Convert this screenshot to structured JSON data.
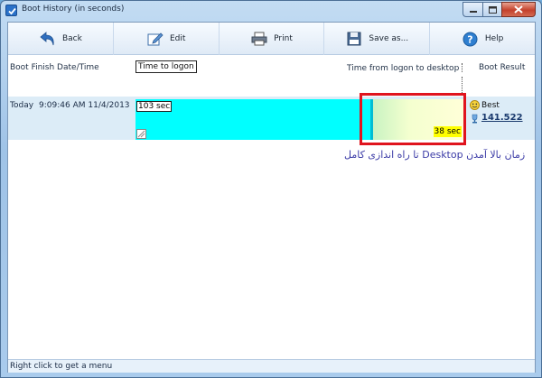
{
  "window": {
    "title": "Boot History (in seconds)"
  },
  "toolbar": {
    "back_label": "Back",
    "edit_label": "Edit",
    "print_label": "Print",
    "save_label": "Save as...",
    "help_label": "Help"
  },
  "columns": {
    "date": "Boot Finish Date/Time",
    "logon": "Time to logon",
    "desktop": "Time from logon to desktop",
    "result": "Boot Result"
  },
  "row": {
    "day": "Today",
    "time": "9:09:46 AM 11/4/2013",
    "logon_value": "103 sec",
    "desktop_value": "38 sec",
    "result_label": "Best",
    "result_value": "141.522"
  },
  "annotation": "زمان بالا آمدن Desktop تا راه اندازی کامل",
  "status": {
    "text": "Right click to get a menu"
  },
  "colors": {
    "logon_bar": "#00ffff",
    "desktop_bar": "#f4ffcf",
    "highlight": "#e0141e",
    "desktop_label_bg": "#ffff00"
  }
}
